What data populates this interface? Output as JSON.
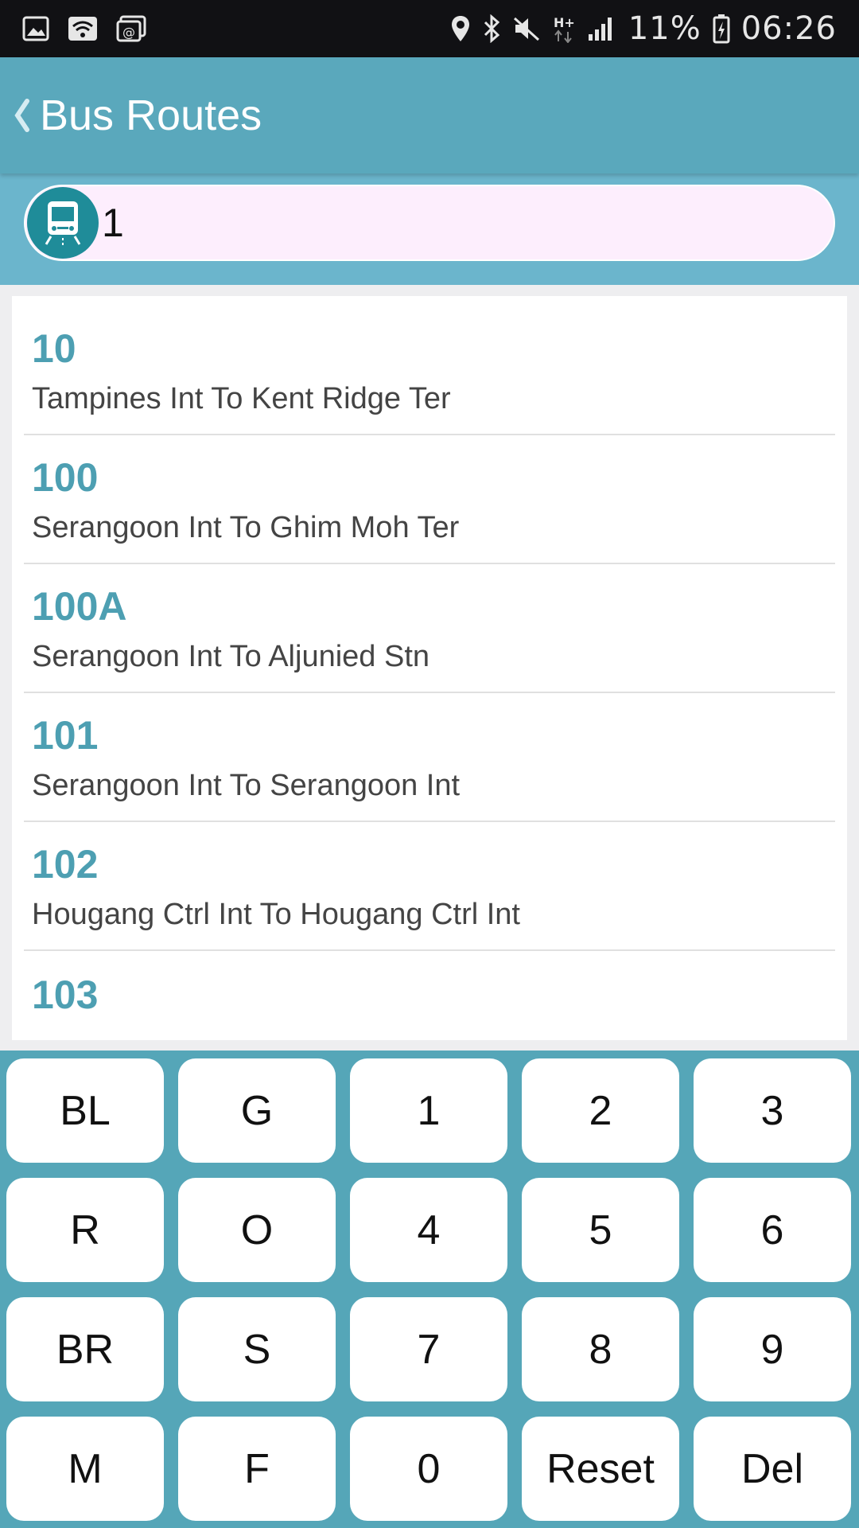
{
  "status_bar": {
    "battery_percent": "11%",
    "time": "06:26",
    "icons": [
      "image-icon",
      "wifi-icon",
      "cast-icon",
      "location-icon",
      "bluetooth-icon",
      "mute-icon",
      "hplus-icon",
      "signal-icon",
      "battery-icon"
    ]
  },
  "app_bar": {
    "title": "Bus Routes",
    "back_icon": "chevron-left-icon",
    "color": "#5aa8bc"
  },
  "search": {
    "value": "1",
    "icon": "bus-icon"
  },
  "routes": [
    {
      "number": "10",
      "description": "Tampines Int To Kent Ridge Ter"
    },
    {
      "number": "100",
      "description": "Serangoon Int To Ghim Moh Ter"
    },
    {
      "number": "100A",
      "description": "Serangoon Int To Aljunied Stn"
    },
    {
      "number": "101",
      "description": "Serangoon Int To Serangoon Int"
    },
    {
      "number": "102",
      "description": "Hougang Ctrl Int To Hougang Ctrl Int"
    },
    {
      "number": "103",
      "description": ""
    }
  ],
  "keypad": {
    "keys": [
      "BL",
      "G",
      "1",
      "2",
      "3",
      "R",
      "O",
      "4",
      "5",
      "6",
      "BR",
      "S",
      "7",
      "8",
      "9",
      "M",
      "F",
      "0",
      "Reset",
      "Del"
    ]
  }
}
